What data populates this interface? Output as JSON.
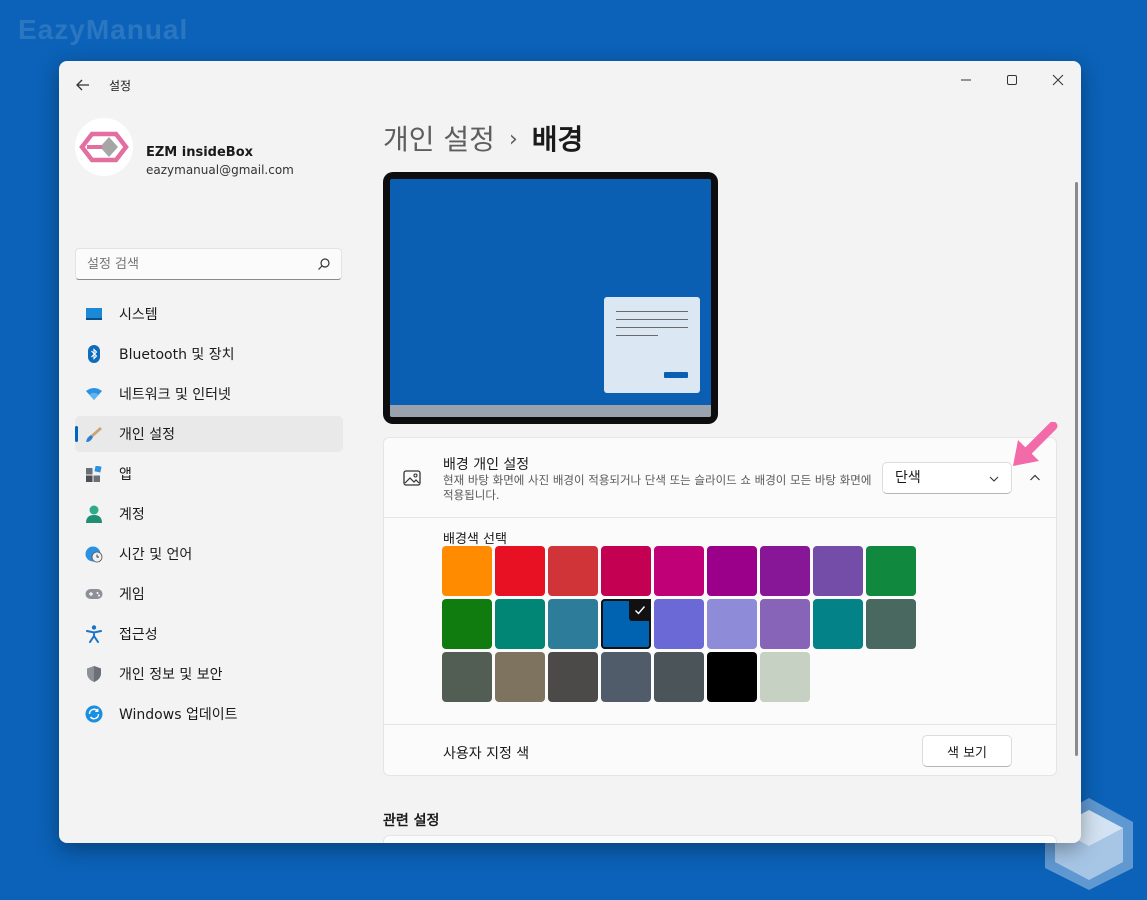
{
  "watermark": "EazyManual",
  "window": {
    "title": "설정"
  },
  "profile": {
    "name": "EZM insideBox",
    "email": "eazymanual@gmail.com"
  },
  "search": {
    "placeholder": "설정 검색"
  },
  "nav": [
    {
      "label": "시스템",
      "icon": "monitor-icon"
    },
    {
      "label": "Bluetooth 및 장치",
      "icon": "bluetooth-icon"
    },
    {
      "label": "네트워크 및 인터넷",
      "icon": "wifi-icon"
    },
    {
      "label": "개인 설정",
      "icon": "paintbrush-icon",
      "selected": true
    },
    {
      "label": "앱",
      "icon": "apps-icon"
    },
    {
      "label": "계정",
      "icon": "person-icon"
    },
    {
      "label": "시간 및 언어",
      "icon": "globe-clock-icon"
    },
    {
      "label": "게임",
      "icon": "gamepad-icon"
    },
    {
      "label": "접근성",
      "icon": "accessibility-icon"
    },
    {
      "label": "개인 정보 및 보안",
      "icon": "shield-icon"
    },
    {
      "label": "Windows 업데이트",
      "icon": "update-icon"
    }
  ],
  "breadcrumb": {
    "parent": "개인 설정",
    "separator": "›",
    "current": "배경"
  },
  "background_card": {
    "title": "배경 개인 설정",
    "description": "현재 바탕 화면에 사진 배경이 적용되거나 단색 또는 슬라이드 쇼 배경이 모든 바탕 화면에 적용됩니다.",
    "selected_option": "단색",
    "swatch_label": "배경색 선택",
    "swatches": [
      "#ff8c00",
      "#e81123",
      "#d13438",
      "#c30052",
      "#bf0077",
      "#9a0089",
      "#881798",
      "#744da9",
      "#10893e",
      "#107c10",
      "#018574",
      "#2d7d9a",
      "#0063b1",
      "#6b69d6",
      "#8e8cd8",
      "#8764b8",
      "#038387",
      "#486860",
      "#525e54",
      "#7e735f",
      "#4c4a48",
      "#515c6b",
      "#4a5459",
      "#000000",
      "#c6d0c3"
    ],
    "selected_swatch": 12,
    "custom_color_label": "사용자 지정 색",
    "view_colors_button": "색 보기"
  },
  "related": {
    "title": "관련 설정"
  },
  "colors": {
    "accent": "#0067c0",
    "desktop": "#0b5fb3",
    "annotation_arrow": "#f36aa8"
  }
}
